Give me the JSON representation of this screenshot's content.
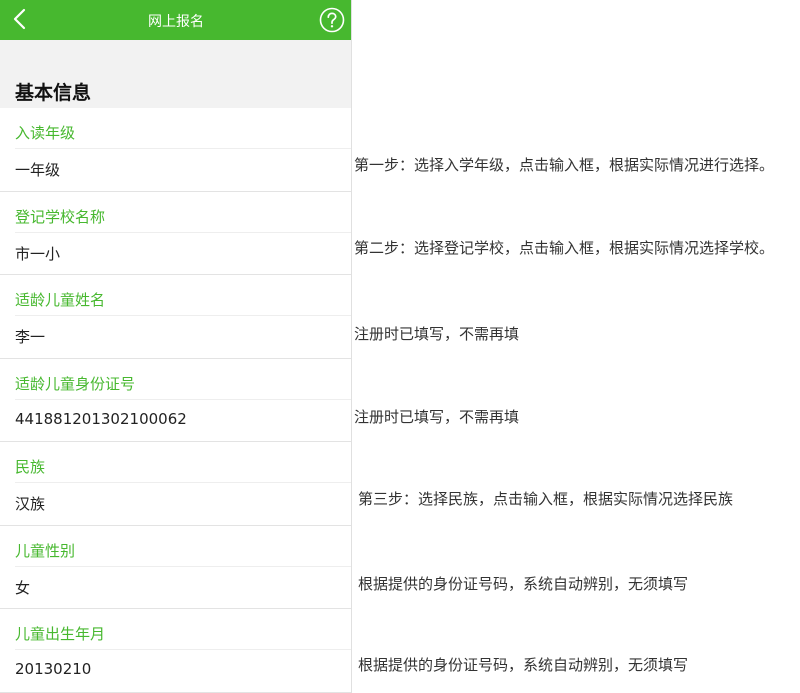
{
  "header": {
    "title": "网上报名",
    "back_icon": "chevron-left-icon",
    "help_icon": "question-circle-icon",
    "color": "#47b82f"
  },
  "section": {
    "title": "基本信息"
  },
  "fields": [
    {
      "label": "入读年级",
      "value": "一年级"
    },
    {
      "label": "登记学校名称",
      "value": "市一小"
    },
    {
      "label": "适龄儿童姓名",
      "value": "李一"
    },
    {
      "label": "适龄儿童身份证号",
      "value": "441881201302100062"
    },
    {
      "label": "民族",
      "value": "汉族"
    },
    {
      "label": "儿童性别",
      "value": "女"
    },
    {
      "label": "儿童出生年月",
      "value": "20130210"
    }
  ],
  "notes": [
    "第一步：选择入学年级，点击输入框，根据实际情况进行选择。",
    "第二步：选择登记学校，点击输入框，根据实际情况选择学校。",
    "注册时已填写，不需再填",
    "注册时已填写，不需再填",
    "第三步：选择民族，点击输入框，根据实际情况选择民族",
    "根据提供的身份证号码，系统自动辨别，无须填写",
    "根据提供的身份证号码，系统自动辨别，无须填写"
  ]
}
